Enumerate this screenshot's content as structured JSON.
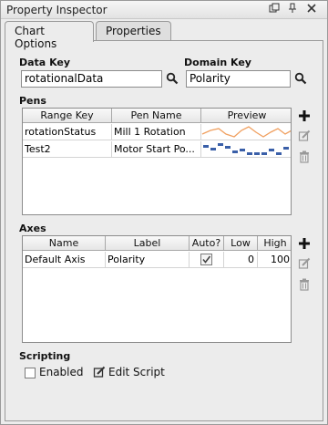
{
  "window": {
    "title": "Property Inspector"
  },
  "tabs": [
    {
      "label": "Chart Options",
      "active": true
    },
    {
      "label": "Properties",
      "active": false
    }
  ],
  "keys": {
    "data_key_label": "Data Key",
    "data_key_value": "rotationalData",
    "domain_key_label": "Domain Key",
    "domain_key_value": "Polarity"
  },
  "pens": {
    "section_label": "Pens",
    "columns": [
      "Range Key",
      "Pen Name",
      "Preview"
    ],
    "rows": [
      {
        "range_key": "rotationStatus",
        "pen_name": "Mill 1 Rotation",
        "preview_style": "line",
        "preview_color": "#f0a060"
      },
      {
        "range_key": "Test2",
        "pen_name": "Motor Start Po...",
        "preview_style": "bars",
        "preview_color": "#3a5fa8"
      }
    ]
  },
  "axes": {
    "section_label": "Axes",
    "columns": [
      "Name",
      "Label",
      "Auto?",
      "Low",
      "High"
    ],
    "rows": [
      {
        "name": "Default Axis",
        "label": "Polarity",
        "auto": true,
        "low": "0",
        "high": "100"
      }
    ]
  },
  "scripting": {
    "section_label": "Scripting",
    "enabled_label": "Enabled",
    "enabled": false,
    "edit_script_label": "Edit Script"
  }
}
